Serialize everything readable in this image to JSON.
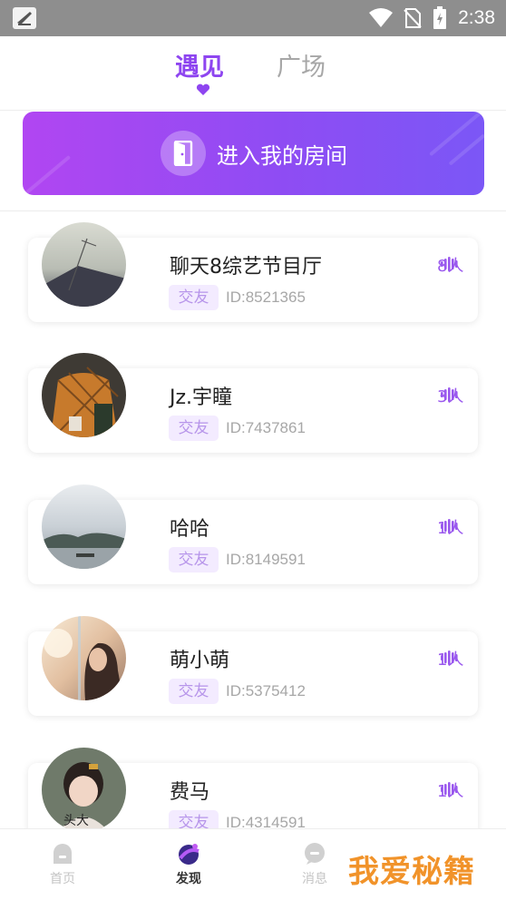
{
  "status_bar": {
    "time": "2:38",
    "icons": [
      "app-notification-icon",
      "wifi-icon",
      "no-sim-icon",
      "battery-charging-icon"
    ]
  },
  "tabs": [
    {
      "label": "遇见",
      "active": true
    },
    {
      "label": "广场",
      "active": false
    }
  ],
  "banner": {
    "label": "进入我的房间",
    "icon": "door-icon"
  },
  "rooms": [
    {
      "name": "聊天8综艺节目厅",
      "tag": "交友",
      "id": "ID:8521365",
      "count": "8人",
      "avatar": "sky-crane-photo"
    },
    {
      "name": "Jz.宇瞳",
      "tag": "交友",
      "id": "ID:7437861",
      "count": "3人",
      "avatar": "plaid-shirt-person-photo"
    },
    {
      "name": "哈哈",
      "tag": "交友",
      "id": "ID:8149591",
      "count": "1人",
      "avatar": "lake-mountain-photo"
    },
    {
      "name": "萌小萌",
      "tag": "交友",
      "id": "ID:5375412",
      "count": "1人",
      "avatar": "girl-sunlight-photo"
    },
    {
      "name": "费马",
      "tag": "交友",
      "id": "ID:4314591",
      "count": "1人",
      "avatar": "child-portrait-photo",
      "avatar_caption": "头大"
    }
  ],
  "bottom_nav": [
    {
      "label": "首页",
      "icon": "home-icon",
      "active": false
    },
    {
      "label": "发现",
      "icon": "discover-icon",
      "active": true
    },
    {
      "label": "消息",
      "icon": "message-icon",
      "active": false
    }
  ],
  "watermark": "我爱秘籍",
  "colors": {
    "accent": "#8e45f0",
    "banner_start": "#b146f2",
    "banner_end": "#7b57f6",
    "tag_bg": "#f3ebff",
    "status_bar": "#8e8e8e"
  }
}
